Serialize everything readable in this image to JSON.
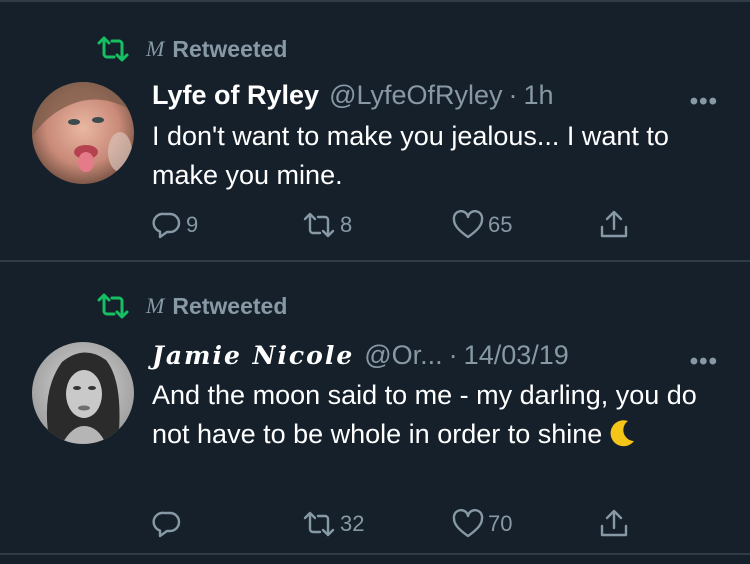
{
  "colors": {
    "background": "#15202b",
    "divider": "#2f3b47",
    "muted": "#8899a6",
    "retweet_green": "#17bf63",
    "text": "#ffffff"
  },
  "tweets": [
    {
      "retweeted_by": "M",
      "retweeted_label": "Retweeted",
      "author_name": "Lyfe of Ryley",
      "handle": "@LyfeOfRyley",
      "separator": "·",
      "time": "1h",
      "more": "•••",
      "text": "I don't want to make you jealous... I want to make you mine.",
      "replies": "9",
      "retweets": "8",
      "likes": "65"
    },
    {
      "retweeted_by": "M",
      "retweeted_label": "Retweeted",
      "author_name": "Jamie Nicole",
      "handle": "@Or...",
      "separator": "·",
      "time": "14/03/19",
      "more": "•••",
      "text": "And the moon said to me - my darling, you do not have to be whole in order to shine",
      "emoji": "crescent-moon",
      "replies": "",
      "retweets": "32",
      "likes": "70"
    }
  ]
}
